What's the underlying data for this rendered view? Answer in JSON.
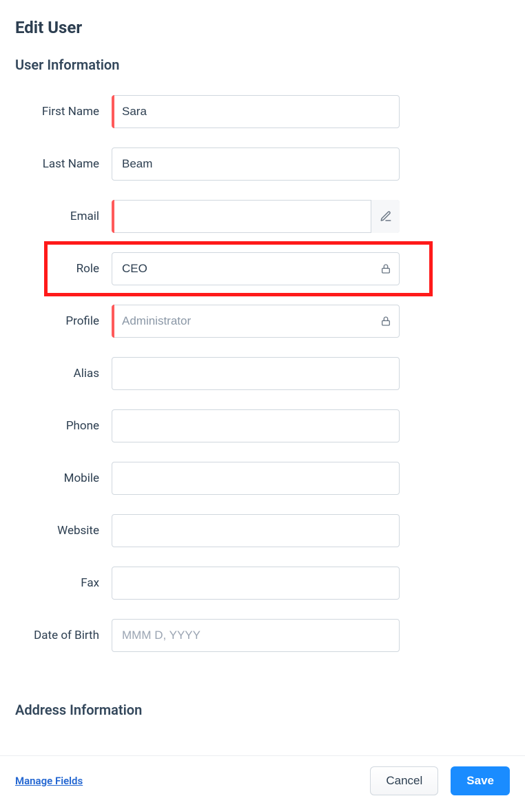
{
  "page_title": "Edit User",
  "sections": {
    "user_info": {
      "title": "User Information",
      "fields": {
        "first_name": {
          "label": "First Name",
          "value": "Sara"
        },
        "last_name": {
          "label": "Last Name",
          "value": "Beam"
        },
        "email": {
          "label": "Email",
          "value": ""
        },
        "role": {
          "label": "Role",
          "value": "CEO"
        },
        "profile": {
          "label": "Profile",
          "value": "Administrator"
        },
        "alias": {
          "label": "Alias",
          "value": ""
        },
        "phone": {
          "label": "Phone",
          "value": ""
        },
        "mobile": {
          "label": "Mobile",
          "value": ""
        },
        "website": {
          "label": "Website",
          "value": ""
        },
        "fax": {
          "label": "Fax",
          "value": ""
        },
        "dob": {
          "label": "Date of Birth",
          "value": "",
          "placeholder": "MMM D, YYYY"
        }
      }
    },
    "address_info": {
      "title": "Address Information"
    }
  },
  "footer": {
    "manage_fields": "Manage Fields",
    "cancel": "Cancel",
    "save": "Save"
  }
}
